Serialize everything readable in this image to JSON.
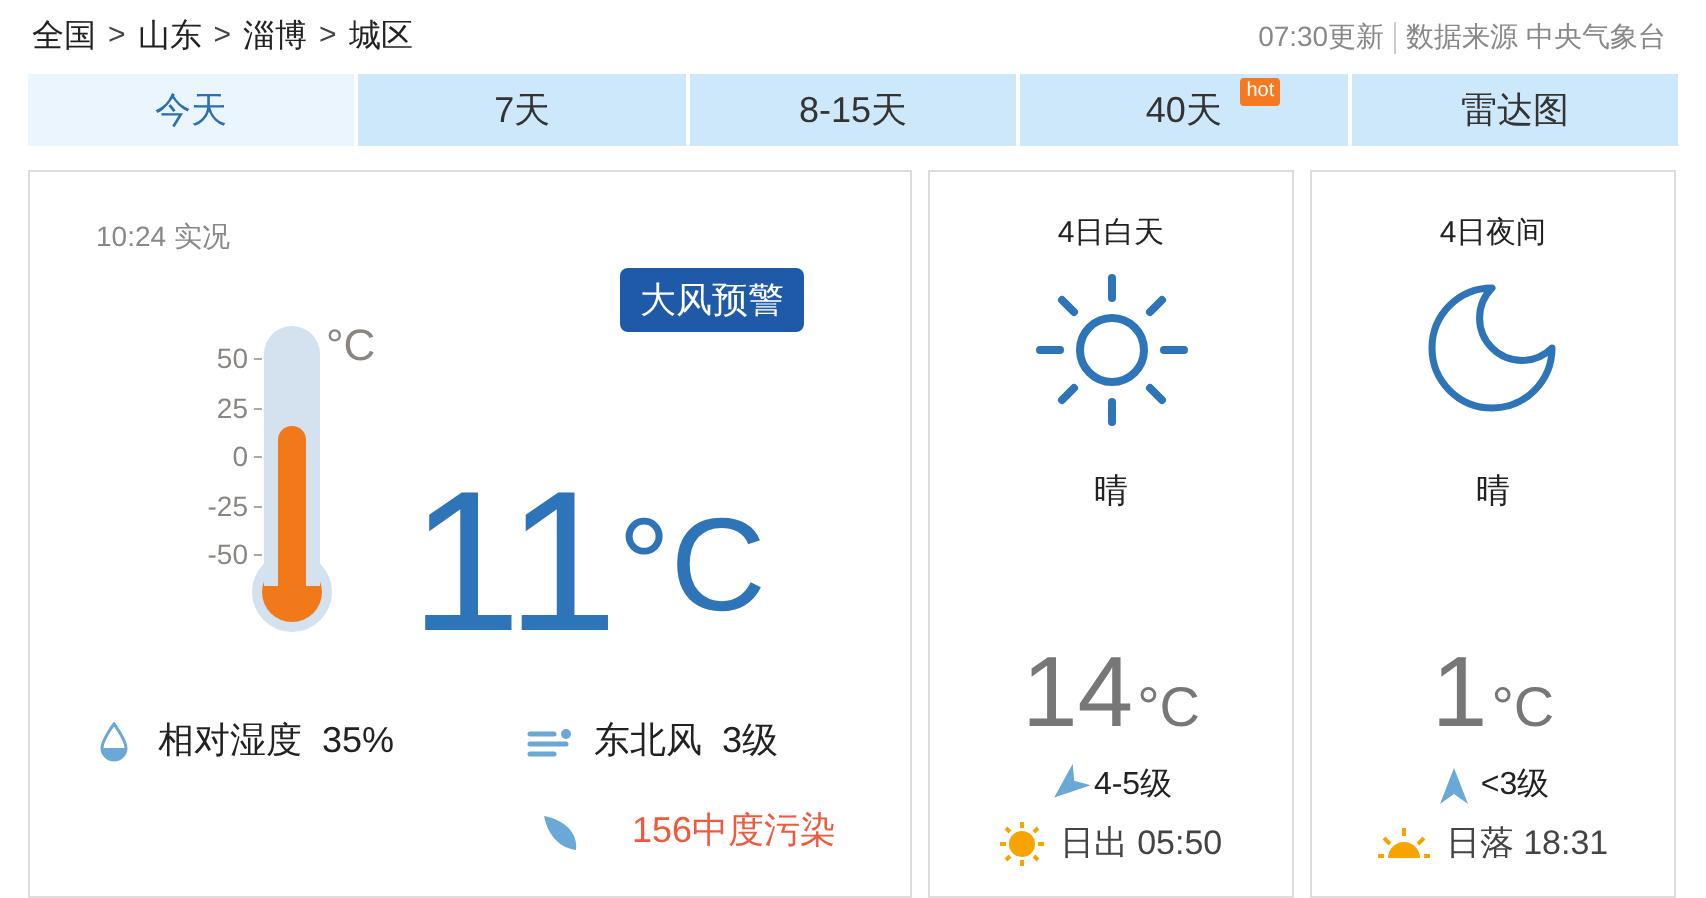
{
  "breadcrumb": [
    {
      "kind": "link",
      "text": "全国"
    },
    {
      "kind": "separator",
      "text": ">"
    },
    {
      "kind": "link",
      "text": "山东"
    },
    {
      "kind": "separator",
      "text": ">"
    },
    {
      "kind": "link",
      "text": "淄博"
    },
    {
      "kind": "separator",
      "text": ">"
    },
    {
      "kind": "link",
      "text": "城区"
    }
  ],
  "update_time": "07:30更新",
  "source": "数据来源 中央气象台",
  "tabs": [
    {
      "label": "今天",
      "selected": true
    },
    {
      "label": "7天",
      "selected": false
    },
    {
      "label": "8-15天",
      "selected": false
    },
    {
      "label": "40天",
      "selected": false,
      "badge": "hot"
    },
    {
      "label": "雷达图",
      "selected": false
    }
  ],
  "current": {
    "observed": "10:24 实况",
    "alert": "大风预警",
    "thermometer": {
      "unit": "°C",
      "ticks": [
        "50",
        "25",
        "0",
        "-25",
        "-50"
      ],
      "level": 0.61
    },
    "temperature": "11",
    "unit": "°C",
    "humidity_label": "相对湿度",
    "humidity": "35%",
    "wind_direction": "东北风",
    "wind_level": "3级",
    "air_quality": "156中度污染"
  },
  "periods": [
    {
      "kind": "day",
      "title": "4日白天",
      "weather": "晴",
      "temperature": "14",
      "unit": "°C",
      "wind": "4-5级",
      "sun": "日出 05:50"
    },
    {
      "kind": "night",
      "title": "4日夜间",
      "weather": "晴",
      "temperature": "1",
      "unit": "°C",
      "wind": "<3级",
      "sun": "日落 18:31"
    }
  ]
}
